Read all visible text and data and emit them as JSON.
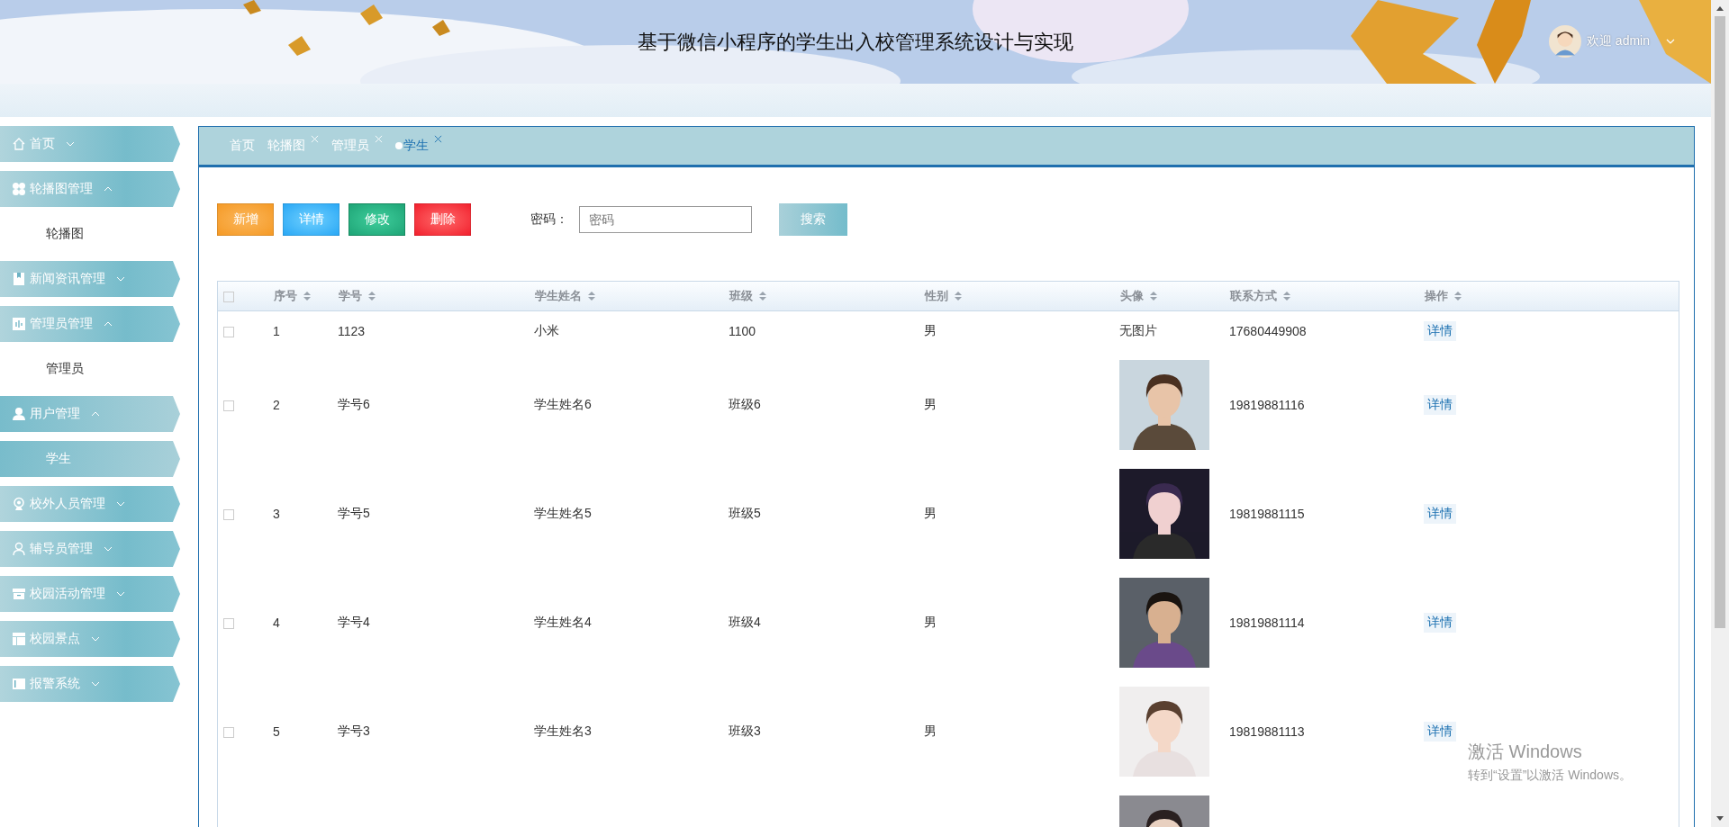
{
  "header": {
    "title": "基于微信小程序的学生出入校管理系统设计与实现",
    "user": "欢迎 admin"
  },
  "sidebar": {
    "items": [
      {
        "label": "首页",
        "expanded": false,
        "selected": false
      },
      {
        "label": "轮播图管理",
        "expanded": true,
        "selected": false,
        "children": [
          {
            "label": "轮播图",
            "selected": false
          }
        ]
      },
      {
        "label": "新闻资讯管理",
        "expanded": false,
        "selected": false
      },
      {
        "label": "管理员管理",
        "expanded": true,
        "selected": false,
        "children": [
          {
            "label": "管理员",
            "selected": false
          }
        ]
      },
      {
        "label": "用户管理",
        "expanded": true,
        "selected": true,
        "children": [
          {
            "label": "学生",
            "selected": true
          }
        ]
      },
      {
        "label": "校外人员管理",
        "expanded": false,
        "selected": false
      },
      {
        "label": "辅导员管理",
        "expanded": false,
        "selected": false
      },
      {
        "label": "校园活动管理",
        "expanded": false,
        "selected": false
      },
      {
        "label": "校园景点",
        "expanded": false,
        "selected": false
      },
      {
        "label": "报警系统",
        "expanded": false,
        "selected": false
      }
    ]
  },
  "tabs": [
    {
      "label": "首页",
      "closable": false,
      "selected": false
    },
    {
      "label": "轮播图",
      "closable": true,
      "selected": false
    },
    {
      "label": "管理员",
      "closable": true,
      "selected": false
    },
    {
      "label": "学生",
      "closable": true,
      "selected": true
    }
  ],
  "toolbar": {
    "buttons": [
      {
        "label": "新增",
        "kind": "add"
      },
      {
        "label": "详情",
        "kind": "detail"
      },
      {
        "label": "修改",
        "kind": "edit"
      },
      {
        "label": "删除",
        "kind": "delete"
      }
    ],
    "search": {
      "label": "密码：",
      "placeholder": "密码",
      "button": "搜索"
    }
  },
  "table": {
    "select_all_checked": false,
    "columns": [
      "序号",
      "学号",
      "学生姓名",
      "班级",
      "性别",
      "头像",
      "联系方式",
      "操作"
    ],
    "rows": [
      {
        "checked": false,
        "cells": [
          "1",
          "1123",
          "小米",
          "1100",
          "男"
        ],
        "avatar": {
          "kind": "text",
          "text": "无图片"
        },
        "phone": "17680449908",
        "action": "详情"
      },
      {
        "checked": false,
        "cells": [
          "2",
          "学号6",
          "学生姓名6",
          "班级6",
          "男"
        ],
        "avatar": {
          "kind": "picture"
        },
        "phone": "19819881116",
        "action": "详情"
      },
      {
        "checked": false,
        "cells": [
          "3",
          "学号5",
          "学生姓名5",
          "班级5",
          "男"
        ],
        "avatar": {
          "kind": "picture"
        },
        "phone": "19819881115",
        "action": "详情"
      },
      {
        "checked": false,
        "cells": [
          "4",
          "学号4",
          "学生姓名4",
          "班级4",
          "男"
        ],
        "avatar": {
          "kind": "picture"
        },
        "phone": "19819881114",
        "action": "详情"
      },
      {
        "checked": false,
        "cells": [
          "5",
          "学号3",
          "学生姓名3",
          "班级3",
          "男"
        ],
        "avatar": {
          "kind": "picture"
        },
        "phone": "19819881113",
        "action": "详情"
      },
      {
        "avatar": {
          "kind": "picture"
        }
      }
    ]
  },
  "os_notice": {
    "title": "激活 Windows",
    "text": "转到“设置”以激活 Windows。"
  }
}
